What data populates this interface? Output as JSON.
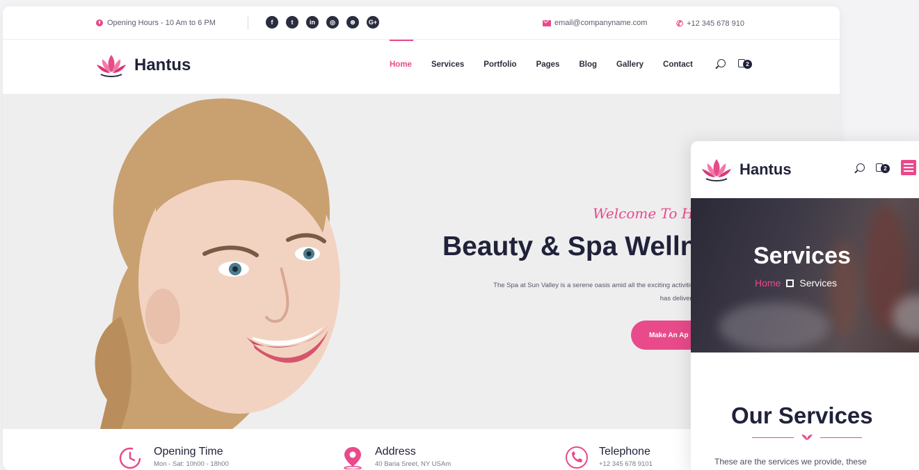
{
  "colors": {
    "accent": "#e84a8a",
    "dark": "#20223a",
    "hero_bg": "#eeeeef"
  },
  "topbar": {
    "hours": "Opening Hours - 10 Am to 6 PM",
    "socials": [
      {
        "icon": "facebook-icon",
        "glyph": "f"
      },
      {
        "icon": "twitter-icon",
        "glyph": "t"
      },
      {
        "icon": "linkedin-icon",
        "glyph": "in"
      },
      {
        "icon": "instagram-icon",
        "glyph": "◎"
      },
      {
        "icon": "dribbble-icon",
        "glyph": "⊛"
      },
      {
        "icon": "google-plus-icon",
        "glyph": "G+"
      }
    ],
    "email": "email@companyname.com",
    "phone": "+12 345 678 910"
  },
  "brand": {
    "name": "Hantus",
    "logo_icon": "lotus-icon"
  },
  "nav": {
    "items": [
      "Home",
      "Services",
      "Portfolio",
      "Pages",
      "Blog",
      "Gallery",
      "Contact"
    ],
    "active": "Home",
    "cart_count": "2"
  },
  "hero": {
    "welcome": "Welcome To Ha",
    "title": "Beauty & Spa Welln",
    "desc_line1": "The Spa at Sun Valley is a serene oasis amid all the exciting activities o",
    "desc_line2": "has delivere",
    "cta": "Make An Ap"
  },
  "info": [
    {
      "icon": "clock-icon",
      "title": "Opening Time",
      "sub": "Mon - Sat: 10h00 - 18h00"
    },
    {
      "icon": "location-pin-icon",
      "title": "Address",
      "sub": "40 Baria Sreet, NY USAm"
    },
    {
      "icon": "phone-icon",
      "title": "Telephone",
      "sub": "+12 345 678 9101"
    }
  ],
  "mobile": {
    "brand": "Hantus",
    "cart_count": "2",
    "banner_title": "Services",
    "breadcrumb_home": "Home",
    "breadcrumb_current": "Services",
    "section_title": "Our Services",
    "section_desc": "These are the services we provide, these"
  }
}
